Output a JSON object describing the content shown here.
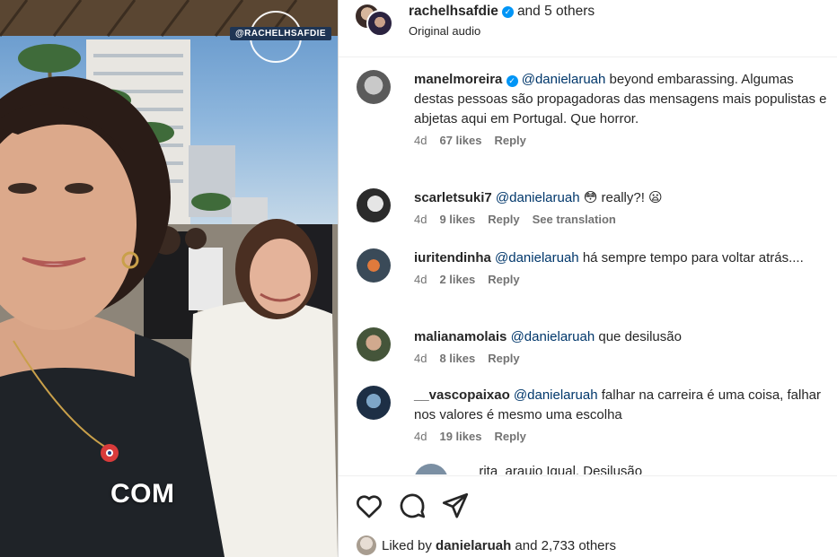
{
  "media": {
    "watermark": "@RACHELHSAFDIE",
    "caption": "COM"
  },
  "header": {
    "username": "rachelhsafdie",
    "others": "and 5 others",
    "audio": "Original audio"
  },
  "comments": [
    {
      "user": "manelmoreira",
      "verified": true,
      "mention": "@danielaruah",
      "text": " beyond embarassing. Algumas destas pessoas são propagadoras das mensagens mais populistas e abjetas aqui em Portugal. Que horror.",
      "time": "4d",
      "likes": "67 likes",
      "reply": "Reply",
      "translation": ""
    },
    {
      "user": "scarletsuki7",
      "verified": false,
      "mention": "@danielaruah",
      "text": " 😳 really?! 😦",
      "time": "4d",
      "likes": "9 likes",
      "reply": "Reply",
      "translation": "See translation"
    },
    {
      "user": "iuritendinha",
      "verified": false,
      "mention": "@danielaruah",
      "text": " há sempre tempo para voltar atrás....",
      "time": "4d",
      "likes": "2 likes",
      "reply": "Reply",
      "translation": ""
    },
    {
      "user": "malianamolais",
      "verified": false,
      "mention": "@danielaruah",
      "text": " que desilusão",
      "time": "4d",
      "likes": "8 likes",
      "reply": "Reply",
      "translation": ""
    },
    {
      "user": "__vascopaixao",
      "verified": false,
      "mention": "@danielaruah",
      "text": " falhar na carreira é uma coisa, falhar nos valores é mesmo uma escolha",
      "time": "4d",
      "likes": "19 likes",
      "reply": "Reply",
      "translation": ""
    }
  ],
  "partial_comment": "_rita_araujo  Igual. Desilusão",
  "liked_by": {
    "prefix": "Liked by ",
    "user": "danielaruah",
    "suffix": " and 2,733 others"
  },
  "icons": {
    "like": "heart-icon",
    "comment": "comment-icon",
    "share": "share-icon",
    "verified": "verified-badge-icon"
  },
  "colors": {
    "verified": "#0095f6",
    "mention": "#00376b",
    "meta": "#737373"
  }
}
